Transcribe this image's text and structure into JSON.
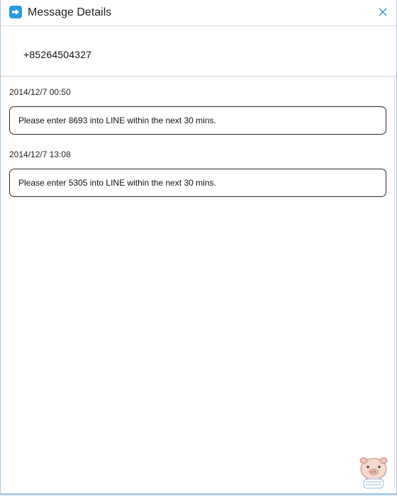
{
  "window": {
    "title": "Message Details",
    "app_icon": "share-arrow-icon",
    "close_icon": "close-icon"
  },
  "contact": {
    "number": "+85264504327"
  },
  "messages": [
    {
      "timestamp": "2014/12/7 00:50",
      "text": "Please enter 8693 into LINE within the next 30 mins."
    },
    {
      "timestamp": "2014/12/7 13:08",
      "text": "Please enter 5305 into LINE within the next 30 mins."
    }
  ],
  "colors": {
    "accent": "#2a9be0",
    "border": "#2b2b2b",
    "frame": "#a9c9e6"
  }
}
